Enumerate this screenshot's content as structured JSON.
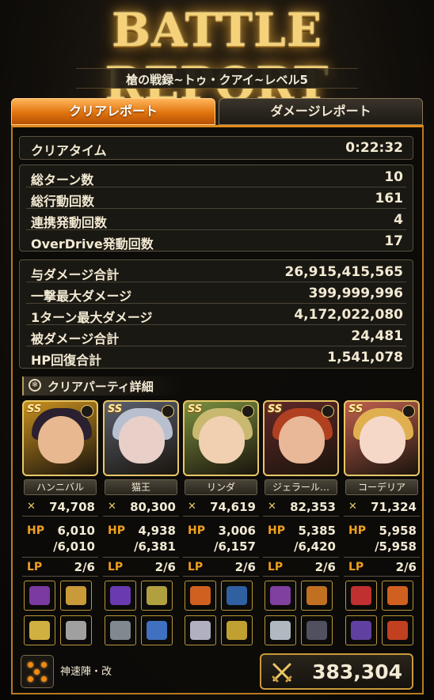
{
  "header": {
    "title": "BATTLE REPORT",
    "subtitle": "槍の戦録~トゥ・クアイ~レベル5"
  },
  "tabs": [
    {
      "label": "クリアレポート",
      "active": true
    },
    {
      "label": "ダメージレポート",
      "active": false
    }
  ],
  "clear_time": {
    "label": "クリアタイム",
    "value": "0:22:32"
  },
  "turn_stats": [
    {
      "label": "総ターン数",
      "value": "10"
    },
    {
      "label": "総行動回数",
      "value": "161"
    },
    {
      "label": "連携発動回数",
      "value": "4"
    },
    {
      "label": "OverDrive発動回数",
      "value": "17"
    }
  ],
  "damage_stats": [
    {
      "label": "与ダメージ合計",
      "value": "26,915,415,565"
    },
    {
      "label": "一撃最大ダメージ",
      "value": "399,999,996"
    },
    {
      "label": "1ターン最大ダメージ",
      "value": "4,172,022,080"
    },
    {
      "label": "被ダメージ合計",
      "value": "24,481"
    },
    {
      "label": "HP回復合計",
      "value": "1,541,078"
    }
  ],
  "party": {
    "title": "クリアパーティ詳細",
    "units": [
      {
        "name": "ハンニバル",
        "rank": "SS",
        "power": "74,708",
        "hp_current": "6,010",
        "hp_max": "/6,010",
        "lp": "2/6",
        "colors": {
          "hair": "#2a2030",
          "face": "#e8b890",
          "bg": "#c89020"
        }
      },
      {
        "name": "猫王",
        "rank": "SS",
        "power": "80,300",
        "hp_current": "4,938",
        "hp_max": "/6,381",
        "lp": "2/6",
        "colors": {
          "hair": "#b8c0d0",
          "face": "#e8d0c8",
          "bg": "#5a6070"
        }
      },
      {
        "name": "リンダ",
        "rank": "SS",
        "power": "74,619",
        "hp_current": "3,006",
        "hp_max": "/6,157",
        "lp": "2/6",
        "colors": {
          "hair": "#c8b870",
          "face": "#f0d0b0",
          "bg": "#7a9040"
        }
      },
      {
        "name": "ジェラール…",
        "rank": "SS",
        "power": "82,353",
        "hp_current": "5,385",
        "hp_max": "/6,420",
        "lp": "2/6",
        "colors": {
          "hair": "#b04020",
          "face": "#e8b898",
          "bg": "#602828"
        }
      },
      {
        "name": "コーデリア",
        "rank": "SS",
        "power": "71,324",
        "hp_current": "5,958",
        "hp_max": "/5,958",
        "lp": "2/6",
        "colors": {
          "hair": "#e0b050",
          "face": "#f5d8c8",
          "bg": "#c06050"
        }
      }
    ]
  },
  "formation": {
    "name": "神速陣・改"
  },
  "total_power": "383,304",
  "labels": {
    "hp": "HP",
    "lp": "LP",
    "ss": "SS"
  }
}
